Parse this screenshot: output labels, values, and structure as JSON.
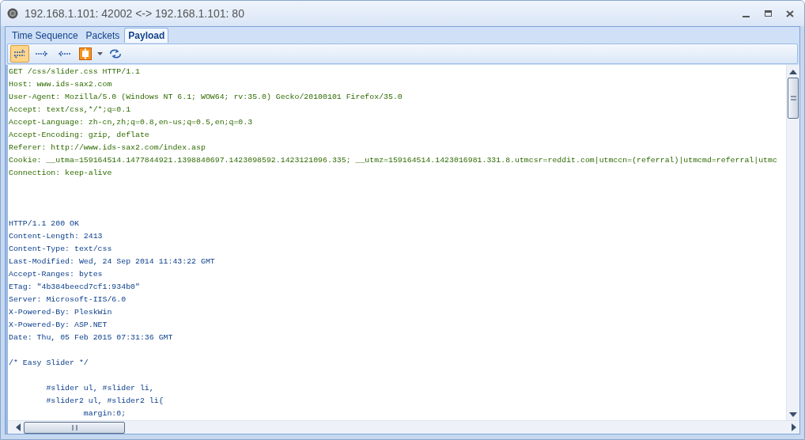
{
  "window": {
    "title": "192.168.1.101: 42002 <-> 192.168.1.101: 80"
  },
  "tabs": [
    {
      "label": "Time Sequence",
      "selected": false
    },
    {
      "label": "Packets",
      "selected": false
    },
    {
      "label": "Payload",
      "selected": true
    }
  ],
  "toolbar": [
    {
      "kind": "both",
      "selected": true
    },
    {
      "kind": "forward",
      "selected": false
    },
    {
      "kind": "back",
      "selected": false
    },
    {
      "kind": "fit",
      "selected": false
    },
    {
      "kind": "refresh",
      "selected": false
    }
  ],
  "payload": [
    {
      "kind": "request",
      "text": "GET /css/slider.css HTTP/1.1"
    },
    {
      "kind": "request",
      "text": "Host: www.ids-sax2.com"
    },
    {
      "kind": "request",
      "text": "User-Agent: Mozilla/5.0 (Windows NT 6.1; WOW64; rv:35.0) Gecko/20100101 Firefox/35.0"
    },
    {
      "kind": "request",
      "text": "Accept: text/css,*/*;q=0.1"
    },
    {
      "kind": "request",
      "text": "Accept-Language: zh-cn,zh;q=0.8,en-us;q=0.5,en;q=0.3"
    },
    {
      "kind": "request",
      "text": "Accept-Encoding: gzip, deflate"
    },
    {
      "kind": "request",
      "text": "Referer: http://www.ids-sax2.com/index.asp"
    },
    {
      "kind": "request",
      "text": "Cookie: __utma=159164514.1477844921.1398840697.1423098592.1423121096.335; __utmz=159164514.1423016981.331.8.utmcsr=reddit.com|utmccn=(referral)|utmcmd=referral|utmc"
    },
    {
      "kind": "request",
      "text": "Connection: keep-alive"
    },
    {
      "kind": "blank"
    },
    {
      "kind": "blank"
    },
    {
      "kind": "blank"
    },
    {
      "kind": "response",
      "text": "HTTP/1.1 200 OK"
    },
    {
      "kind": "response",
      "text": "Content-Length: 2413"
    },
    {
      "kind": "response",
      "text": "Content-Type: text/css"
    },
    {
      "kind": "response",
      "text": "Last-Modified: Wed, 24 Sep 2014 11:43:22 GMT"
    },
    {
      "kind": "response",
      "text": "Accept-Ranges: bytes"
    },
    {
      "kind": "response",
      "text": "ETag: \"4b384beecd7cf1:934b0\""
    },
    {
      "kind": "response",
      "text": "Server: Microsoft-IIS/6.0"
    },
    {
      "kind": "response",
      "text": "X-Powered-By: PleskWin"
    },
    {
      "kind": "response",
      "text": "X-Powered-By: ASP.NET"
    },
    {
      "kind": "response",
      "text": "Date: Thu, 05 Feb 2015 07:31:36 GMT"
    },
    {
      "kind": "blank"
    },
    {
      "kind": "response",
      "text": "/* Easy Slider */"
    },
    {
      "kind": "blank"
    },
    {
      "kind": "response",
      "text": "        #slider ul, #slider li,"
    },
    {
      "kind": "response",
      "text": "        #slider2 ul, #slider2 li{"
    },
    {
      "kind": "response",
      "text": "                margin:0;"
    }
  ]
}
